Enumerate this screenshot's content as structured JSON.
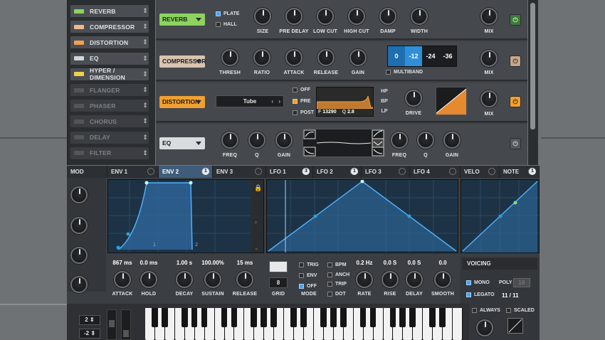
{
  "fx_list": [
    {
      "label": "REVERB",
      "led": "#8dd35f",
      "on": true
    },
    {
      "label": "COMPRESSOR",
      "led": "#f0b890",
      "on": true
    },
    {
      "label": "DISTORTION",
      "led": "#f0a050",
      "on": true
    },
    {
      "label": "EQ",
      "led": "#cfd6dc",
      "on": true
    },
    {
      "label": "HYPER / DIMENSION",
      "led": "#f2d04a",
      "on": true
    },
    {
      "label": "FLANGER",
      "led": "#555",
      "on": false
    },
    {
      "label": "PHASER",
      "led": "#555",
      "on": false
    },
    {
      "label": "CHORUS",
      "led": "#555",
      "on": false
    },
    {
      "label": "DELAY",
      "led": "#555",
      "on": false
    },
    {
      "label": "FILTER",
      "led": "#555",
      "on": false
    }
  ],
  "reverb": {
    "name": "REVERB",
    "plate": "PLATE",
    "hall": "HALL",
    "knobs": [
      "SIZE",
      "PRE DELAY",
      "LOW CUT",
      "HIGH CUT",
      "DAMP",
      "WIDTH"
    ],
    "mix": "MIX",
    "color": "#8dd35f"
  },
  "compressor": {
    "name": "COMPRESSOR",
    "knobs": [
      "THRESH",
      "RATIO",
      "ATTACK",
      "RELEASE",
      "GAIN"
    ],
    "bands": [
      "0",
      "-12",
      "-24",
      "-36"
    ],
    "multiband": "MULTIBAND",
    "mix": "MIX",
    "color": "#d9c3b0"
  },
  "distortion": {
    "name": "DISTORTION",
    "type": "Tube",
    "off": "OFF",
    "pre": "PRE",
    "post": "POST",
    "freq": "13290",
    "q": "2.8",
    "filters": [
      "HP",
      "BP",
      "LP"
    ],
    "drive": "DRIVE",
    "mix": "MIX",
    "fq": "F",
    "ql": "Q",
    "color": "#f0a030"
  },
  "eq": {
    "name": "EQ",
    "left": [
      "FREQ",
      "Q",
      "GAIN"
    ],
    "right": [
      "FREQ",
      "Q",
      "GAIN"
    ],
    "color": "#d8dcdf"
  },
  "mod": {
    "tabs": [
      "MOD",
      "ENV 1",
      "ENV 2",
      "ENV 3",
      "LFO 1",
      "LFO 2",
      "LFO 3",
      "LFO 4",
      "VELO",
      "NOTE"
    ],
    "env2_count": "1",
    "lfo1_count": "3",
    "lfo2_count": "1",
    "note_count": "1"
  },
  "env": {
    "values": [
      "867 ms",
      "0.0 ms",
      "1.00 s",
      "100.00%",
      "15 ms"
    ],
    "labels": [
      "ATTACK",
      "HOLD",
      "DECAY",
      "SUSTAIN",
      "RELEASE"
    ],
    "marks": [
      "1",
      "2"
    ]
  },
  "lfo": {
    "grid_label": "GRID",
    "grid_value": "8",
    "mode_label": "MODE",
    "trig": "TRIG",
    "env": "ENV",
    "off": "OFF",
    "bpm": "BPM",
    "anch": "ANCH",
    "trip": "TRIP",
    "dot": "DOT",
    "values": [
      "0.2 Hz",
      "0.0 S",
      "0.0 S",
      "0.0"
    ],
    "labels": [
      "RATE",
      "RISE",
      "DELAY",
      "SMOOTH"
    ]
  },
  "voicing": {
    "title": "VOICING",
    "mono": "MONO",
    "legato": "LEGATO",
    "poly": "POLY",
    "poly_value": "16",
    "count": "11 / 11",
    "always": "ALWAYS",
    "scaled": "SCALED"
  },
  "keyboard": {
    "oct1": "2",
    "oct2": "-2"
  }
}
